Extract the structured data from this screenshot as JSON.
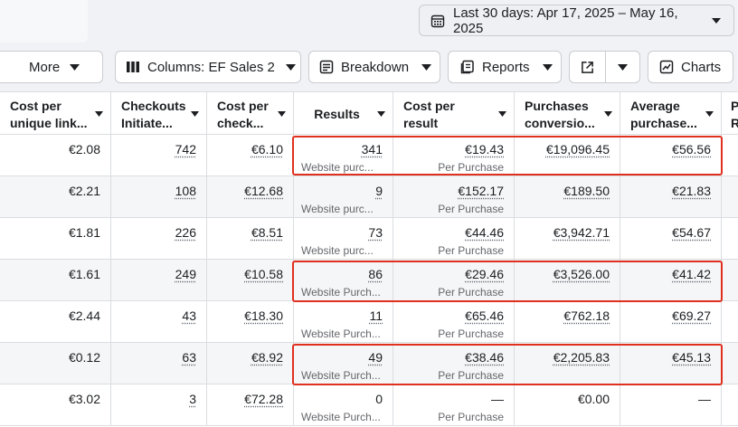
{
  "header": {
    "date_range": "Last 30 days: Apr 17, 2025 – May 16, 2025"
  },
  "toolbar": {
    "more": "More",
    "columns": "Columns: EF Sales 2",
    "breakdown": "Breakdown",
    "reports": "Reports",
    "charts": "Charts"
  },
  "columns": [
    "Cost per unique link...",
    "Checkouts Initiate...",
    "Cost per check...",
    "Results",
    "Cost per result",
    "Purchases conversio...",
    "Average purchase...",
    "P R"
  ],
  "rows": [
    {
      "cost_unique": "€2.08",
      "checkouts": "742",
      "cost_checkout": "€6.10",
      "results": "341",
      "results_sub": "Website purc...",
      "cpr": "€19.43",
      "cpr_sub": "Per Purchase",
      "purchases": "€19,096.45",
      "avg": "€56.56"
    },
    {
      "cost_unique": "€2.21",
      "checkouts": "108",
      "cost_checkout": "€12.68",
      "results": "9",
      "results_sub": "Website purc...",
      "cpr": "€152.17",
      "cpr_sub": "Per Purchase",
      "purchases": "€189.50",
      "avg": "€21.83"
    },
    {
      "cost_unique": "€1.81",
      "checkouts": "226",
      "cost_checkout": "€8.51",
      "results": "73",
      "results_sub": "Website purc...",
      "cpr": "€44.46",
      "cpr_sub": "Per Purchase",
      "purchases": "€3,942.71",
      "avg": "€54.67"
    },
    {
      "cost_unique": "€1.61",
      "checkouts": "249",
      "cost_checkout": "€10.58",
      "results": "86",
      "results_sub": "Website Purch...",
      "cpr": "€29.46",
      "cpr_sub": "Per Purchase",
      "purchases": "€3,526.00",
      "avg": "€41.42"
    },
    {
      "cost_unique": "€2.44",
      "checkouts": "43",
      "cost_checkout": "€18.30",
      "results": "11",
      "results_sub": "Website Purch...",
      "cpr": "€65.46",
      "cpr_sub": "Per Purchase",
      "purchases": "€762.18",
      "avg": "€69.27"
    },
    {
      "cost_unique": "€0.12",
      "checkouts": "63",
      "cost_checkout": "€8.92",
      "results": "49",
      "results_sub": "Website Purch...",
      "cpr": "€38.46",
      "cpr_sub": "Per Purchase",
      "purchases": "€2,205.83",
      "avg": "€45.13"
    },
    {
      "cost_unique": "€3.02",
      "checkouts": "3",
      "cost_checkout": "€72.28",
      "results": "0",
      "results_sub": "Website Purch...",
      "cpr": "—",
      "cpr_sub": "Per Purchase",
      "purchases": "€0.00",
      "avg": "—"
    }
  ],
  "colors": {
    "highlight": "#e0301e",
    "border": "#dadde1",
    "alt_row": "#f5f6f7"
  }
}
